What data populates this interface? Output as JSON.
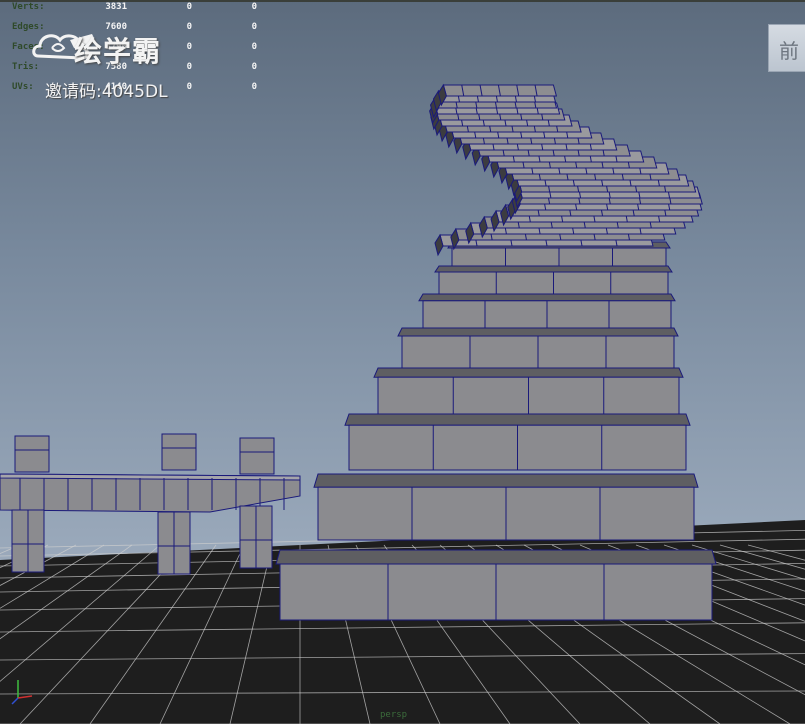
{
  "hud": {
    "rows": [
      {
        "label": "Verts:",
        "values": [
          "3831",
          "0",
          "0"
        ]
      },
      {
        "label": "Edges:",
        "values": [
          "7600",
          "0",
          "0"
        ]
      },
      {
        "label": "Faces:",
        "values": [
          "3790",
          "0",
          "0"
        ]
      },
      {
        "label": "Tris:",
        "values": [
          "7580",
          "0",
          "0"
        ]
      },
      {
        "label": "UVs:",
        "values": [
          "4140",
          "0",
          "0"
        ]
      }
    ]
  },
  "watermark": {
    "brand": "绘学霸",
    "invite": "邀请码:4045DL"
  },
  "viewcube": {
    "label": "前"
  },
  "camera": {
    "label": "persp"
  },
  "colors": {
    "mesh_face": "#8b8b8f",
    "mesh_edge": "#1a1a7a",
    "grid_line": "#cfcfcf",
    "ground": "#1e1e1e"
  },
  "icons": [
    "cloud-logo-icon",
    "axis-gizmo-icon"
  ]
}
